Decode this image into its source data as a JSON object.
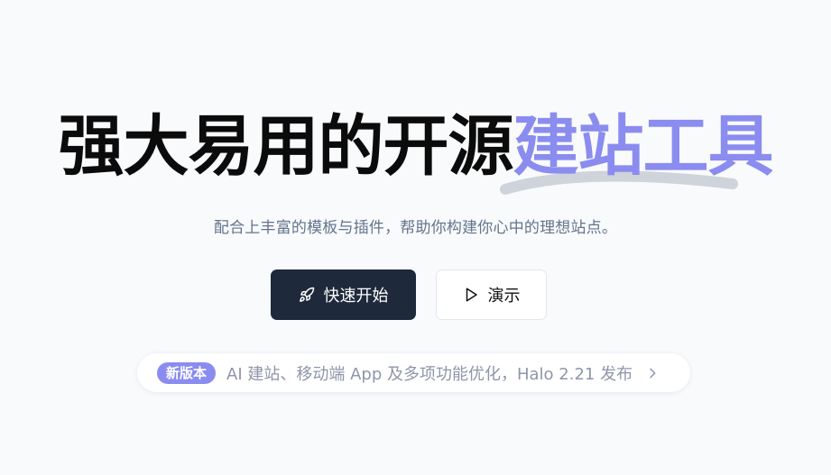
{
  "hero": {
    "headline_main": "强大易用的开源",
    "headline_accent": "建站工具",
    "subtitle": "配合上丰富的模板与插件，帮助你构建你心中的理想站点。"
  },
  "actions": {
    "primary_label": "快速开始",
    "primary_icon": "rocket-icon",
    "secondary_label": "演示",
    "secondary_icon": "play-icon"
  },
  "announcement": {
    "badge": "新版本",
    "text": "AI 建站、移动端 App 及多项功能优化，Halo 2.21 发布",
    "icon": "chevron-right-icon"
  },
  "colors": {
    "accent": "#8a8cef",
    "primary_button": "#1e293b",
    "background": "#f8fafc"
  }
}
